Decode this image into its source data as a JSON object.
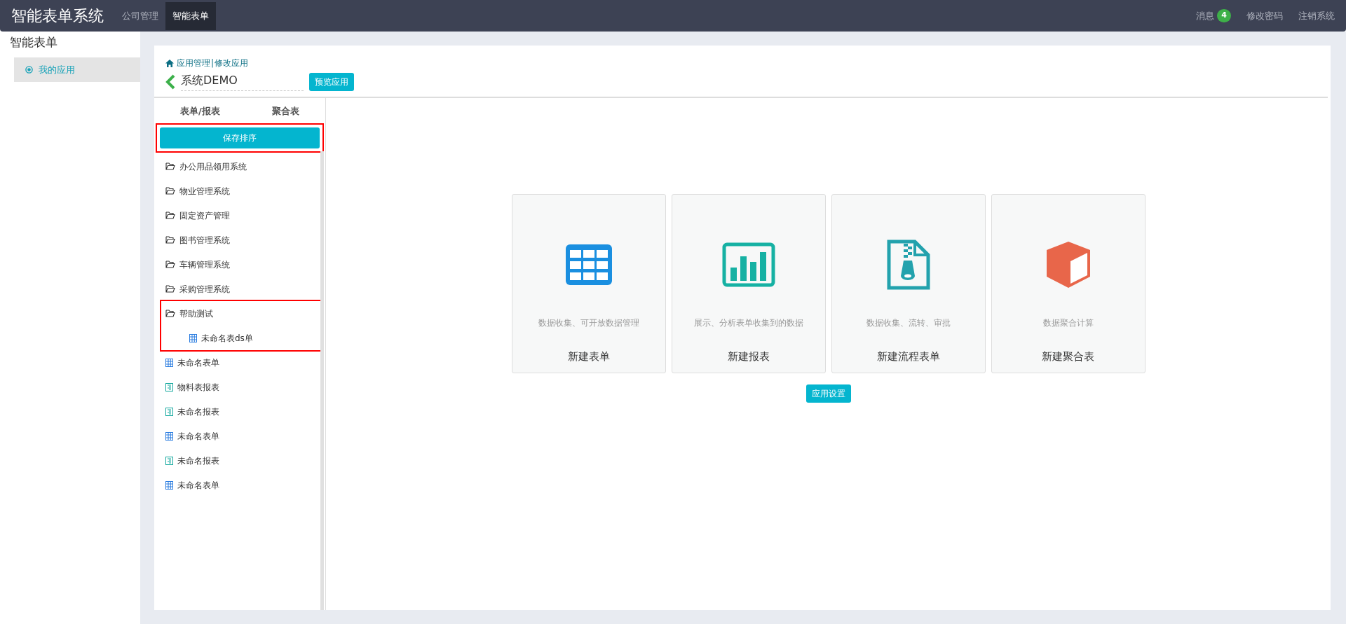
{
  "navbar": {
    "brand": "智能表单系统",
    "items": [
      {
        "label": "公司管理",
        "selected": false
      },
      {
        "label": "智能表单",
        "selected": true
      }
    ],
    "right": [
      {
        "label": "消息",
        "badge": "4"
      },
      {
        "label": "修改密码"
      },
      {
        "label": "注销系统"
      }
    ]
  },
  "sidebar": {
    "title": "智能表单",
    "items": [
      {
        "label": "我的应用",
        "selected": true
      }
    ]
  },
  "breadcrumb": {
    "links": [
      "应用管理",
      "修改应用"
    ],
    "separator": "|"
  },
  "app": {
    "name": "系统DEMO",
    "preview_button": "预览应用"
  },
  "list_tabs": [
    "表单/报表",
    "聚合表"
  ],
  "save_button": "保存排序",
  "tree": [
    {
      "kind": "folder",
      "label": "办公用品领用系统",
      "highlighted": false
    },
    {
      "kind": "folder",
      "label": "物业管理系统",
      "highlighted": false
    },
    {
      "kind": "folder",
      "label": "固定资产管理",
      "highlighted": false
    },
    {
      "kind": "folder",
      "label": "图书管理系统",
      "highlighted": false
    },
    {
      "kind": "folder",
      "label": "车辆管理系统",
      "highlighted": false
    },
    {
      "kind": "folder",
      "label": "采购管理系统",
      "highlighted": false
    },
    {
      "kind": "folder",
      "label": "帮助测试",
      "highlighted": true,
      "children": [
        {
          "kind": "form",
          "label": "未命名表ds单"
        }
      ]
    },
    {
      "kind": "form",
      "label": "未命名表单",
      "highlighted": false
    },
    {
      "kind": "report",
      "label": "物料表报表",
      "highlighted": false
    },
    {
      "kind": "report",
      "label": "未命名报表",
      "highlighted": false
    },
    {
      "kind": "form",
      "label": "未命名表单",
      "highlighted": false
    },
    {
      "kind": "report",
      "label": "未命名报表",
      "highlighted": false
    },
    {
      "kind": "form",
      "label": "未命名表单",
      "highlighted": false
    }
  ],
  "cards": [
    {
      "kind": "form",
      "description": "数据收集、可开放数据管理",
      "title": "新建表单"
    },
    {
      "kind": "report",
      "description": "展示、分析表单收集到的数据",
      "title": "新建报表"
    },
    {
      "kind": "flow",
      "description": "数据收集、流转、审批",
      "title": "新建流程表单"
    },
    {
      "kind": "aggregate",
      "description": "数据聚合计算",
      "title": "新建聚合表"
    }
  ],
  "settings_button": "应用设置"
}
